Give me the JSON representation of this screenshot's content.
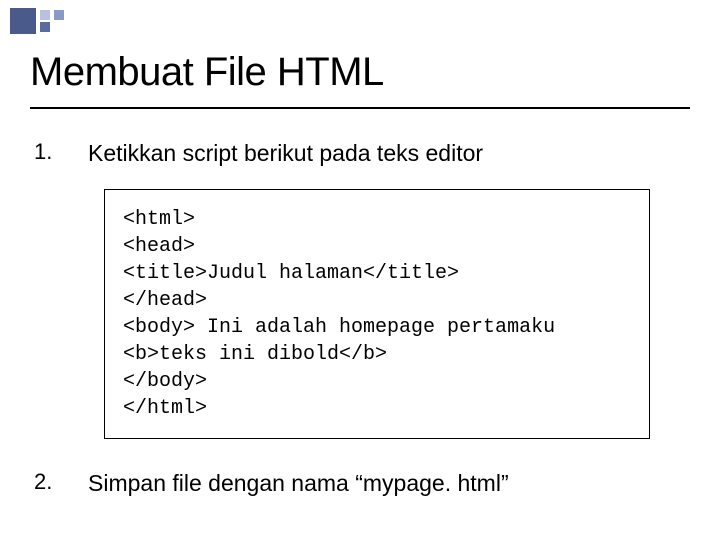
{
  "title": "Membuat File HTML",
  "items": [
    {
      "num": "1.",
      "text": "Ketikkan script berikut pada teks editor"
    },
    {
      "num": "2.",
      "text": "Simpan file dengan nama “mypage. html”"
    }
  ],
  "code": [
    "<html>",
    "<head>",
    "<title>Judul halaman</title>",
    "</head>",
    "<body> Ini adalah homepage pertamaku",
    "<b>teks ini dibold</b>",
    "</body>",
    "</html>"
  ]
}
